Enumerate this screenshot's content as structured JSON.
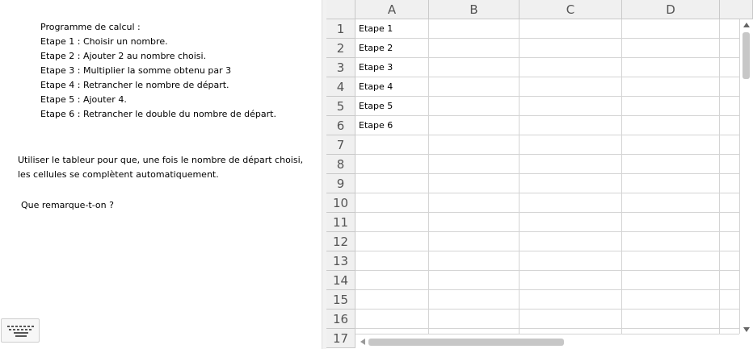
{
  "left": {
    "program_title": "Programme de calcul :",
    "steps": [
      "Etape 1 : Choisir un nombre.",
      "Etape 2 : Ajouter 2 au nombre choisi.",
      "Etape 3 : Multiplier la somme obtenu par 3",
      "Etape 4 : Retrancher le nombre de départ.",
      "Etape 5 : Ajouter 4.",
      "Etape 6 : Retrancher le double du nombre de départ."
    ],
    "instructions": [
      "Utiliser le tableur pour que, une fois le nombre de départ choisi,",
      "les cellules se complètent automatiquement."
    ],
    "question": "Que remarque-t-on ?",
    "keyboard_icon": "keyboard-icon"
  },
  "sheet": {
    "columns": [
      "A",
      "B",
      "C",
      "D"
    ],
    "rows": [
      "1",
      "2",
      "3",
      "4",
      "5",
      "6",
      "7",
      "8",
      "9",
      "10",
      "11",
      "12",
      "13",
      "14",
      "15",
      "16",
      "17"
    ],
    "cells_A": [
      "Etape 1",
      "Etape 2",
      "Etape 3",
      "Etape 4",
      "Etape 5",
      "Etape 6",
      "",
      "",
      "",
      "",
      "",
      "",
      "",
      "",
      "",
      "",
      ""
    ]
  },
  "colors": {
    "header_bg": "#f0f0f0",
    "grid_line": "#d4d4d4",
    "scroll_thumb": "#c7c7c7"
  }
}
